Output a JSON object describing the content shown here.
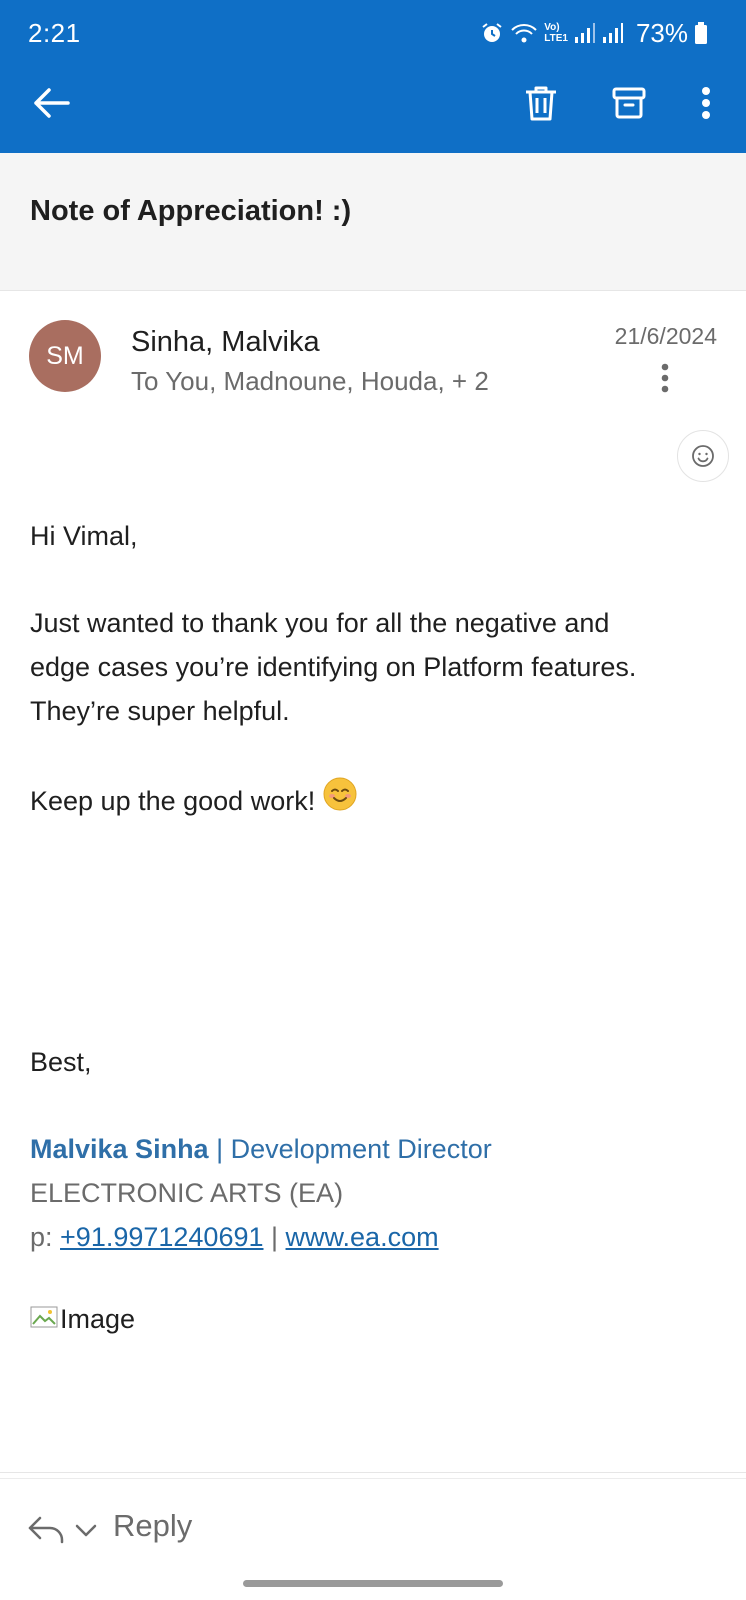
{
  "status_bar": {
    "time": "2:21",
    "network_label_top": "Vo)",
    "network_label_bottom": "LTE1",
    "battery": "73%"
  },
  "toolbar": {
    "back_icon": "arrow-left-icon",
    "trash_icon": "trash-icon",
    "archive_icon": "archive-icon",
    "more_icon": "more-vertical-icon"
  },
  "email": {
    "subject": "Note of Appreciation! :)",
    "avatar_initials": "SM",
    "avatar_color": "#a96e60",
    "sender": "Sinha, Malvika",
    "recipients": "To You, Madnoune, Houda, + 2",
    "date": "21/6/2024",
    "body": {
      "greeting": "Hi Vimal,",
      "paragraph_lines": [
        "Just wanted to thank you for all the negative and",
        "edge cases you’re identifying on Platform features.",
        "They’re super helpful."
      ],
      "keep_up": "Keep up the good work!",
      "closing": "Best,"
    },
    "signature": {
      "name": "Malvika Sinha",
      "separator": " | ",
      "title": "Development Director",
      "company": "ELECTRONIC ARTS (EA)",
      "phone_prefix": "p: ",
      "phone": "+91.9971240691",
      "site": "www.ea.com",
      "image_alt": "Image"
    }
  },
  "reply": {
    "label": "Reply"
  },
  "colors": {
    "app_bar": "#0f6fc6",
    "link": "#1a66a8",
    "signature_name": "#2f6fa8"
  }
}
